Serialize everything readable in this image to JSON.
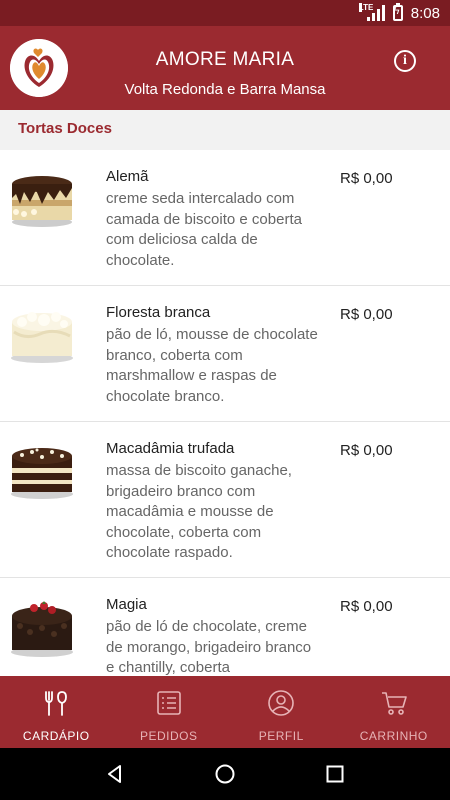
{
  "status_bar": {
    "network": "LTE",
    "time": "8:08"
  },
  "app_bar": {
    "title": "AMORE MARIA",
    "subtitle": "Volta Redonda e Barra Mansa",
    "info_icon": "info-icon"
  },
  "section": {
    "title": "Tortas Doces"
  },
  "items": [
    {
      "name": "Alemã",
      "description": "creme seda intercalado com camada de biscoito e coberta com deliciosa calda de chocolate.",
      "price": "R$ 0,00"
    },
    {
      "name": "Floresta branca",
      "description": "pão de ló, mousse de chocolate branco, coberta com marshmallow e raspas de chocolate branco.",
      "price": "R$ 0,00"
    },
    {
      "name": "Macadâmia trufada",
      "description": "massa de biscoito ganache, brigadeiro branco com macadâmia e mousse de chocolate, coberta com chocolate raspado.",
      "price": "R$ 0,00"
    },
    {
      "name": "Magia",
      "description": "pão de ló de chocolate, creme de morango, brigadeiro branco e chantilly, coberta",
      "price": "R$ 0,00"
    }
  ],
  "bottom_nav": [
    {
      "label": "CARDÁPIO",
      "icon": "cutlery-icon",
      "active": true
    },
    {
      "label": "PEDIDOS",
      "icon": "list-icon",
      "active": false
    },
    {
      "label": "PERFIL",
      "icon": "profile-icon",
      "active": false
    },
    {
      "label": "CARRINHO",
      "icon": "cart-icon",
      "active": false
    }
  ],
  "colors": {
    "primary": "#9b2a30",
    "status_bar": "#7a1c22",
    "accent_text": "#9b2a30"
  }
}
